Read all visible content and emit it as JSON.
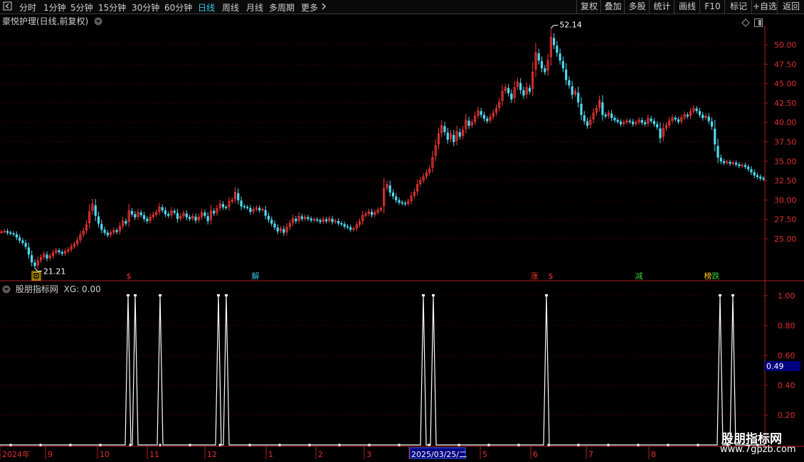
{
  "toolbar": {
    "back_icon": "back-arrow-icon",
    "periods": [
      "分时",
      "1分钟",
      "5分钟",
      "15分钟",
      "30分钟",
      "60分钟",
      "日线",
      "周线",
      "月线",
      "多周期",
      "更多"
    ],
    "active_period": "日线",
    "more_icon": "chevron-right-icon",
    "right_buttons": [
      "复权",
      "叠加",
      "多股",
      "统计",
      "画线",
      "F10",
      "标记",
      "+自选",
      "返回"
    ]
  },
  "main_chart": {
    "title": "豪悦护理(日线,前复权)",
    "title_icon": "chevron-down-icon",
    "corner_icons": [
      "diamond-icon",
      "layout-toggle-icon"
    ],
    "high_label": "52.14",
    "low_label": "21.21",
    "y_ticks": [
      "50.00",
      "47.50",
      "45.00",
      "42.50",
      "40.00",
      "37.50",
      "35.00",
      "32.50",
      "30.00",
      "27.50",
      "25.00"
    ],
    "markers": [
      {
        "text": "回",
        "color": "#ffcc00",
        "boxed": true
      },
      {
        "text": "$",
        "color": "#ff3333",
        "boxed": false
      },
      {
        "text": "解",
        "color": "#35c6e8",
        "boxed": false
      },
      {
        "text": "涨",
        "color": "#ff3333",
        "boxed": false
      },
      {
        "text": "$",
        "color": "#ff3333",
        "boxed": false
      },
      {
        "text": "减",
        "color": "#33cc33",
        "boxed": false
      },
      {
        "text": "榜",
        "color": "#ffcc00",
        "boxed": false
      },
      {
        "text": "跌",
        "color": "#33cc33",
        "boxed": false
      }
    ]
  },
  "indicator": {
    "title_icon": "chevron-down-icon",
    "title": "股朋指标网",
    "value_label": "XG: 0.00",
    "y_ticks": [
      "1.00",
      "0.80",
      "0.60",
      "0.40",
      "0.20"
    ],
    "cursor_value": "0.49",
    "signal_count": 10
  },
  "date_axis": {
    "labels": [
      "2024年",
      "9",
      "10",
      "11",
      "12",
      "1",
      "2",
      "3",
      "2025/03/25/二",
      "5",
      "6",
      "7",
      "8"
    ]
  },
  "watermark": {
    "line1": "股朋指标网",
    "line2": "www.7gpzb.com"
  },
  "chart_data": [
    {
      "type": "candlestick",
      "title": "豪悦护理(日线,前复权)",
      "series": [
        {
          "name": "价格",
          "close": [
            25.9,
            26.0,
            25.8,
            25.7,
            25.6,
            25.2,
            24.8,
            24.5,
            24.0,
            23.0,
            22.0,
            21.5,
            22.2,
            22.6,
            23.0,
            22.5,
            22.8,
            23.2,
            23.5,
            23.3,
            23.1,
            23.4,
            23.6,
            24.0,
            24.3,
            24.8,
            25.5,
            26.0,
            26.8,
            28.5,
            29.5,
            28.0,
            27.0,
            26.2,
            25.8,
            25.5,
            25.8,
            26.1,
            25.9,
            26.6,
            27.3,
            27.0,
            28.6,
            28.2,
            27.8,
            28.4,
            28.1,
            27.6,
            27.3,
            27.8,
            28.1,
            28.4,
            29.1,
            28.7,
            28.2,
            28.0,
            28.6,
            28.4,
            27.6,
            27.9,
            28.3,
            27.8,
            27.6,
            27.9,
            27.4,
            27.8,
            28.4,
            28.0,
            27.3,
            28.6,
            28.3,
            28.9,
            29.5,
            29.1,
            29.0,
            29.8,
            30.0,
            31.0,
            30.0,
            29.2,
            29.1,
            29.0,
            28.5,
            28.8,
            29.0,
            28.7,
            28.8,
            28.0,
            27.5,
            27.0,
            26.5,
            26.0,
            26.3,
            25.8,
            26.5,
            27.0,
            27.6,
            27.3,
            27.9,
            27.6,
            27.8,
            27.6,
            27.4,
            27.5,
            27.4,
            27.2,
            27.5,
            27.3,
            27.6,
            27.2,
            27.3,
            27.0,
            26.9,
            26.6,
            26.5,
            26.2,
            26.3,
            26.8,
            27.2,
            28.0,
            28.2,
            28.5,
            28.1,
            28.4,
            28.7,
            28.9,
            31.5,
            32.0,
            31.0,
            30.5,
            30.0,
            29.7,
            29.6,
            29.5,
            29.8,
            30.5,
            31.0,
            32.0,
            32.5,
            33.0,
            33.5,
            34.0,
            35.5,
            37.0,
            38.5,
            39.6,
            38.8,
            37.8,
            38.5,
            37.5,
            38.8,
            38.2,
            39.0,
            40.3,
            39.6,
            40.0,
            40.8,
            41.5,
            41.0,
            40.5,
            40.2,
            40.7,
            41.2,
            41.8,
            42.6,
            44.0,
            44.5,
            43.8,
            43.0,
            44.5,
            45.2,
            44.2,
            43.5,
            44.5,
            44.0,
            46.5,
            49.0,
            48.0,
            47.0,
            46.5,
            48.0,
            51.0,
            50.0,
            49.0,
            48.0,
            47.0,
            45.5,
            44.8,
            43.6,
            44.0,
            42.6,
            41.0,
            40.2,
            39.6,
            40.3,
            41.2,
            41.8,
            42.8,
            41.0,
            40.8,
            41.2,
            40.6,
            40.3,
            40.1,
            39.8,
            40.0,
            40.2,
            40.1,
            39.8,
            40.0,
            40.3,
            40.0,
            39.8,
            40.5,
            40.2,
            39.8,
            39.4,
            38.0,
            39.2,
            39.6,
            40.2,
            40.6,
            40.4,
            40.1,
            40.6,
            41.0,
            40.8,
            41.4,
            41.8,
            41.5,
            41.0,
            40.6,
            40.8,
            40.2,
            39.5,
            37.2,
            35.5,
            35.0,
            34.8,
            34.9,
            34.7,
            34.8,
            34.6,
            34.4,
            34.5,
            34.3,
            34.0,
            33.6,
            33.2,
            33.0,
            32.8,
            32.7
          ]
        }
      ],
      "high": 52.14,
      "low": 21.21,
      "ylim": [
        22.5,
        53.0
      ],
      "y_ticks": [
        50.0,
        47.5,
        45.0,
        42.5,
        40.0,
        37.5,
        35.0,
        32.5,
        30.0,
        27.5,
        25.0
      ],
      "grid": true
    },
    {
      "type": "line",
      "title": "股朋指标网",
      "series": [
        {
          "name": "XG",
          "values": [
            1,
            1,
            1,
            1,
            1,
            1,
            1,
            1,
            1,
            1
          ]
        }
      ],
      "ylim": [
        0,
        1.0
      ],
      "y_ticks": [
        1.0,
        0.8,
        0.6,
        0.4,
        0.2
      ],
      "grid": true
    }
  ]
}
